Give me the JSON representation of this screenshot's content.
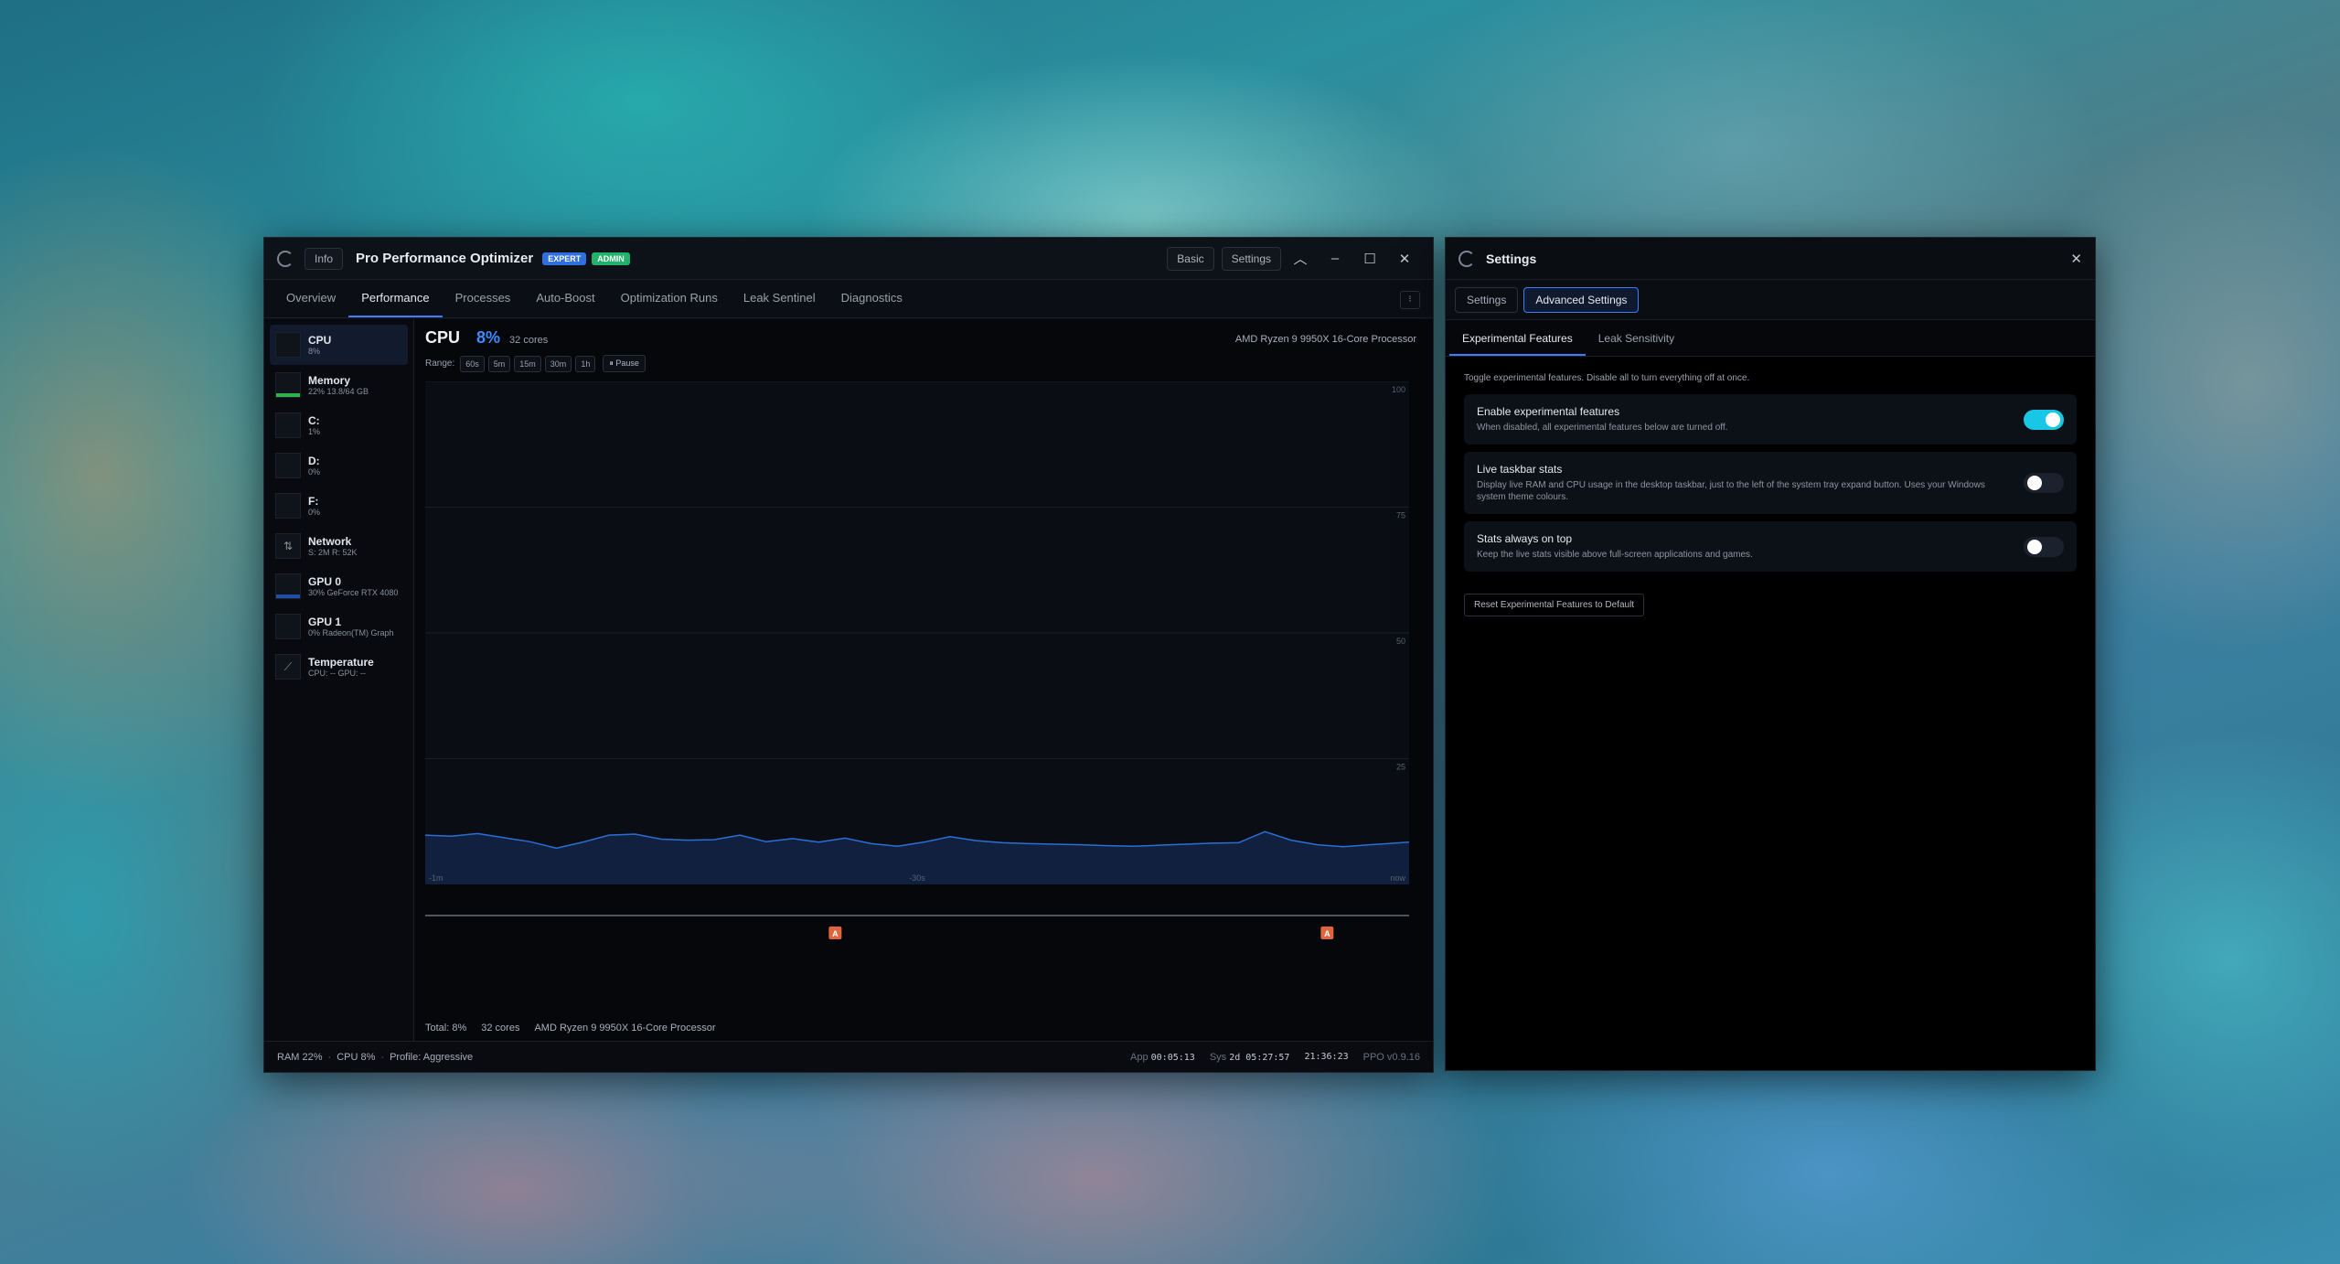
{
  "main": {
    "info_label": "Info",
    "title": "Pro Performance Optimizer",
    "badge_expert": "EXPERT",
    "badge_admin": "ADMIN",
    "basic_label": "Basic",
    "settings_label": "Settings",
    "tabs": [
      "Overview",
      "Performance",
      "Processes",
      "Auto-Boost",
      "Optimization Runs",
      "Leak Sentinel",
      "Diagnostics"
    ],
    "tabs_more": "⁝",
    "sidebar": [
      {
        "name": "CPU",
        "sub": "8%"
      },
      {
        "name": "Memory",
        "sub": "22%  13.8/64 GB"
      },
      {
        "name": "C:",
        "sub": "1%"
      },
      {
        "name": "D:",
        "sub": "0%"
      },
      {
        "name": "F:",
        "sub": "0%"
      },
      {
        "name": "Network",
        "sub": "S: 2M  R: 52K"
      },
      {
        "name": "GPU 0",
        "sub": "30%  GeForce RTX 4080"
      },
      {
        "name": "GPU 1",
        "sub": "0%  Radeon(TM) Graph"
      },
      {
        "name": "Temperature",
        "sub": "CPU: --  GPU: --"
      }
    ],
    "cpu_title": "CPU",
    "cpu_pct": "8%",
    "cpu_cores": "32 cores",
    "cpu_model": "AMD Ryzen 9 9950X 16-Core Processor",
    "range_label": "Range:",
    "ranges": [
      "60s",
      "5m",
      "15m",
      "30m",
      "1h"
    ],
    "pause_label": "⏸ Pause",
    "footer": {
      "total": "Total: 8%",
      "cores": "32 cores",
      "model": "AMD Ryzen 9 9950X 16-Core Processor"
    },
    "status": {
      "ram": "RAM 22%",
      "cpu": "CPU 8%",
      "profile": "Profile: Aggressive",
      "app_label": "App",
      "app_time": "00:05:13",
      "sys_label": "Sys",
      "sys_time": "2d 05:27:57",
      "clock": "21:36:23",
      "version": "PPO v0.9.16"
    }
  },
  "chart_data": {
    "type": "area",
    "title": "",
    "xlabel": "",
    "ylabel": "",
    "ylim": [
      0,
      100
    ],
    "yticks": [
      "100",
      "75",
      "50",
      "25"
    ],
    "xtick_labels": [
      "-1m",
      "-30s",
      "now"
    ],
    "grid": true,
    "series": [
      {
        "color": "#2b6fd6",
        "values": [
          9.8,
          9.6,
          10.1,
          9.3,
          8.5,
          7.2,
          8.4,
          9.8,
          10.0,
          9.0,
          8.8,
          8.9,
          9.8,
          8.5,
          9.1,
          8.4,
          9.2,
          8.1,
          7.6,
          8.4,
          9.5,
          8.7,
          8.3,
          8.1,
          8.0,
          7.9,
          7.7,
          7.6,
          7.8,
          8.0,
          8.2,
          8.3,
          10.5,
          8.8,
          7.9,
          7.5,
          7.9,
          8.4
        ],
        "x": [
          -60,
          -58.4,
          -56.8,
          -55.2,
          -53.6,
          -52,
          -50.4,
          -48.8,
          -47.2,
          -45.6,
          -44,
          -42.4,
          -40.8,
          -39.2,
          -37.6,
          -36,
          -34.4,
          -32.8,
          -31.2,
          -29.6,
          -28,
          -26.4,
          -24.8,
          -23.2,
          -21.6,
          -20,
          -18.4,
          -16.8,
          -15.2,
          -13.6,
          -12,
          -10.4,
          -8.8,
          -7.2,
          -5.6,
          -4,
          -2.4,
          0
        ]
      }
    ],
    "markers": [
      {
        "x": -35,
        "label": "A",
        "color": "#e0643c"
      },
      {
        "x": -5,
        "label": "A",
        "color": "#e0643c"
      }
    ]
  },
  "settings": {
    "title": "Settings",
    "tabs": [
      "Settings",
      "Advanced Settings"
    ],
    "sub_tabs": [
      "Experimental Features",
      "Leak Sensitivity"
    ],
    "description": "Toggle experimental features. Disable all to turn everything off at once.",
    "toggles": [
      {
        "title": "Enable experimental features",
        "sub": "When disabled, all experimental features below are turned off.",
        "on": true
      },
      {
        "title": "Live taskbar stats",
        "sub": "Display live RAM and CPU usage in the desktop taskbar, just to the left of the system tray expand button. Uses your Windows system theme colours.",
        "on": false
      },
      {
        "title": "Stats always on top",
        "sub": "Keep the live stats visible above full-screen applications and games.",
        "on": false
      }
    ],
    "reset_label": "Reset Experimental Features to Default"
  }
}
